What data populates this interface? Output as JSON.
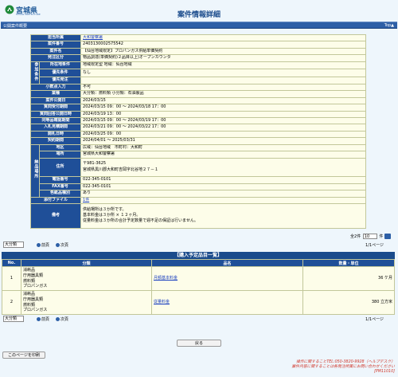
{
  "header": {
    "logo_text": "宮城県",
    "logo_sub": "MIYAGI PREFECTURE",
    "title": "案件情報詳細"
  },
  "section": {
    "label": "公開案件概要",
    "top_link": "Top"
  },
  "detail": {
    "rows": [
      {
        "label": "担当所属",
        "value": "大和警察署",
        "link": true
      },
      {
        "label": "案件番号",
        "value": "2403130002575542"
      },
      {
        "label": "案件名",
        "value": "【仙台地域限定】プロパンガス供給単価契約"
      },
      {
        "label": "発注区分",
        "value": "物品調達(単価契約)２品目以上)オープンカウンタ"
      }
    ],
    "group1": {
      "label": "参加条件",
      "rows": [
        {
          "label": "所在地条件",
          "value": "地域限定型 地域：仙台地域"
        },
        {
          "label": "優先条件",
          "value": "なし"
        },
        {
          "label": "優先発注",
          "value": ""
        }
      ]
    },
    "rows2": [
      {
        "label": "小数点入力",
        "value": "不可"
      },
      {
        "label": "業種",
        "value": "大分類：燃料類 小分類：石油製品"
      },
      {
        "label": "案件公開日",
        "value": "2024/03/15"
      },
      {
        "label": "質問受付期間",
        "value": "2024/03/15 09：00 〜 2024/03/18 17：00"
      },
      {
        "label": "質問回答公開日時",
        "value": "2024/03/19 13：00"
      },
      {
        "label": "同等品確認期間",
        "value": "2024/03/15 09：00 〜 2024/03/19 17：00"
      },
      {
        "label": "入札見積期間",
        "value": "2024/03/21 09：00 〜 2024/03/22 17：00"
      },
      {
        "label": "開札日時",
        "value": "2024/03/25 09：00"
      },
      {
        "label": "契約期間",
        "value": "2024/04/01 〜 2025/03/31"
      }
    ],
    "group2": {
      "label": "納品場所",
      "rows": [
        {
          "label": "地区",
          "value": "広域：仙台地域　市町村：大和町"
        },
        {
          "label": "場所",
          "value": "宮城県大和警察署"
        },
        {
          "label": "住所",
          "value": "〒981-3625\n宮城県黒川郡大和町吉岡字北谷地２７－１"
        },
        {
          "label": "電話番号",
          "value": "022-345-0101"
        },
        {
          "label": "FAX番号",
          "value": "022-345-0101"
        },
        {
          "label": "色紙品種別",
          "value": "あり"
        }
      ]
    },
    "attachment": {
      "label": "添付ファイル",
      "value": "1件"
    },
    "remarks": {
      "label": "備考",
      "value": "供給場所は３か所です。\n基本料金は３か所 × １２ヶ月。\n従量料金は３か所の合計予定数量で週不足の保証は行いません。"
    }
  },
  "listing": {
    "count_prefix": "全2件",
    "per_page": "10",
    "per_page_suffix": "件",
    "sort_select": "大分類",
    "prev_label": "前頁",
    "next_label": "次頁",
    "page_label": "1/1ページ"
  },
  "items": {
    "title": "【購入予定品目一覧】",
    "headers": {
      "no": "No.",
      "category": "分類",
      "name": "品名",
      "qty": "数量・単位"
    },
    "rows": [
      {
        "no": "1",
        "category": "消耗品\n庁用器具類\n燃料類\nプロパンガス",
        "name": "月額基本料金",
        "qty": "36 ケ月"
      },
      {
        "no": "2",
        "category": "消耗品\n庁用器具類\n燃料類\nプロパンガス",
        "name": "従量料金",
        "qty": "380 立方米"
      }
    ]
  },
  "buttons": {
    "back": "戻る",
    "print": "このページを印刷"
  },
  "footer": {
    "line1": "操作に関することTEL:050-3820-9928（ヘルプデスク）",
    "line2": "案件内容に関することは各発注所属にお問い合わせください",
    "line3": "[PM11010]"
  }
}
